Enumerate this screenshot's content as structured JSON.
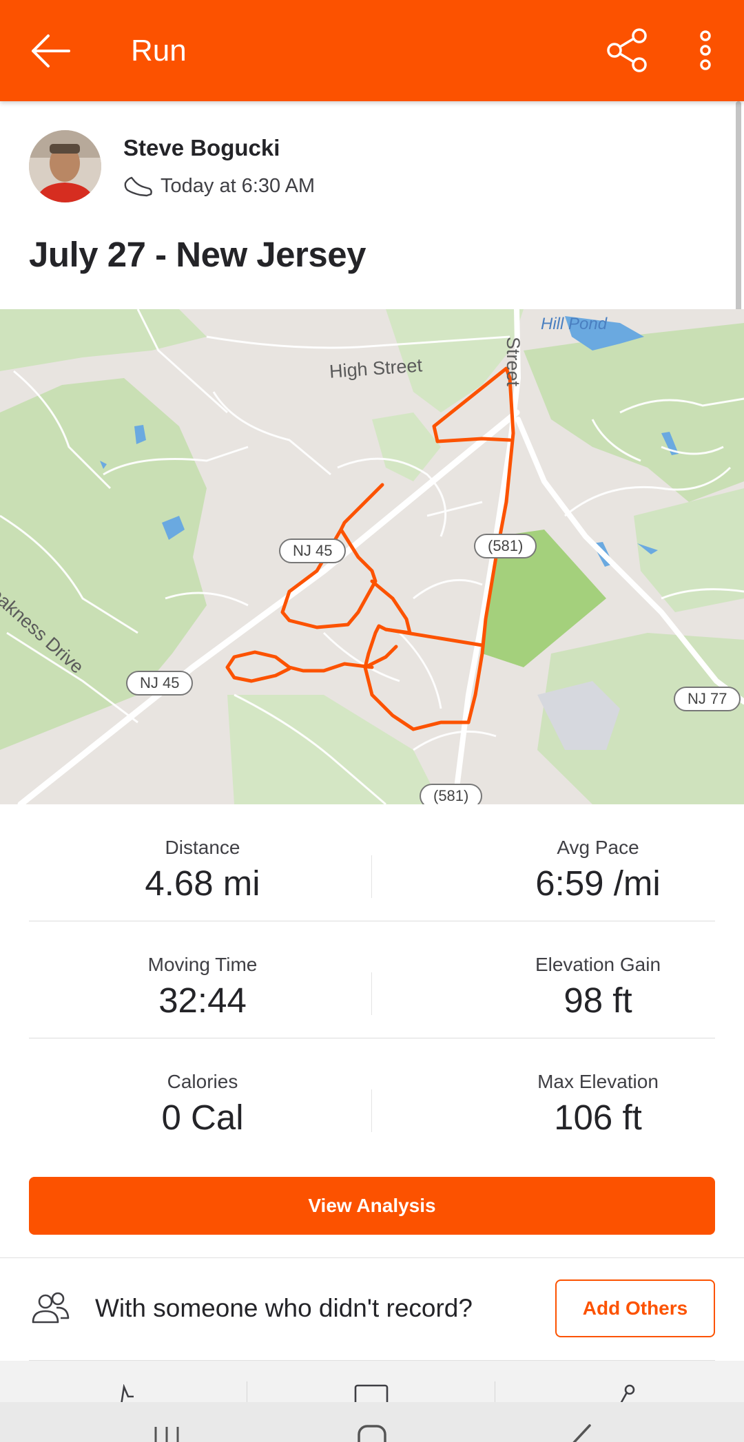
{
  "app_bar": {
    "title": "Run",
    "color": "#fc5200",
    "back_icon": "arrow-left-icon",
    "share_icon": "share-icon",
    "more_icon": "more-vertical-icon"
  },
  "athlete": {
    "name": "Steve Bogucki",
    "activity_icon": "shoe-icon",
    "timestamp": "Today at 6:30 AM"
  },
  "activity": {
    "title": "July 27 - New Jersey"
  },
  "map": {
    "labels": {
      "high_street": "High Street",
      "street": "Street",
      "hill_pond": "Hill Pond",
      "breakness_drive": "Breakness Drive",
      "nj45_a": "NJ 45",
      "nj45_b": "NJ 45",
      "r581_a": "(581)",
      "r581_b": "(581)",
      "nj77": "NJ 77"
    },
    "route_color": "#fc5200"
  },
  "stats": [
    {
      "left_label": "Distance",
      "left_value": "4.68 mi",
      "right_label": "Avg Pace",
      "right_value": "6:59 /mi"
    },
    {
      "left_label": "Moving Time",
      "left_value": "32:44",
      "right_label": "Elevation Gain",
      "right_value": "98 ft"
    },
    {
      "left_label": "Calories",
      "left_value": "0 Cal",
      "right_label": "Max Elevation",
      "right_value": "106 ft"
    }
  ],
  "analysis_button": "View Analysis",
  "with_others": {
    "icon": "people-icon",
    "text": "With someone who didn't record?",
    "button": "Add Others"
  },
  "bottom_actions": [
    "kudos-icon",
    "comment-icon",
    "share-icon"
  ],
  "system_nav": [
    "recents-icon",
    "home-icon",
    "back-icon"
  ]
}
